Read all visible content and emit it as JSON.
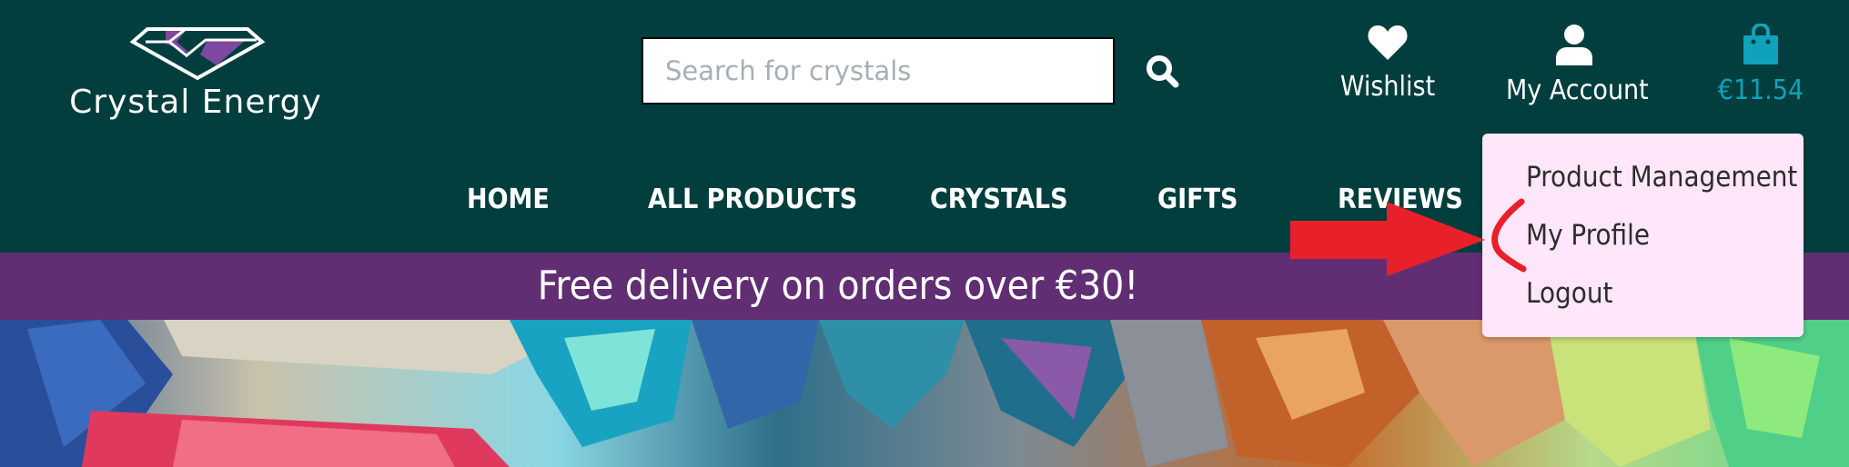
{
  "brand": {
    "name": "Crystal Energy",
    "logo_icon": "crystal-logo"
  },
  "search": {
    "placeholder": "Search for crystals",
    "value": "",
    "icon": "search-icon"
  },
  "actions": {
    "wishlist": {
      "label": "Wishlist",
      "icon": "heart-icon"
    },
    "account": {
      "label": "My Account",
      "icon": "user-icon"
    },
    "cart": {
      "label": "€11.54",
      "icon": "shopping-bag-icon"
    }
  },
  "nav": {
    "items": [
      {
        "label": "HOME"
      },
      {
        "label": "ALL PRODUCTS"
      },
      {
        "label": "CRYSTALS"
      },
      {
        "label": "GIFTS"
      },
      {
        "label": "REVIEWS"
      }
    ]
  },
  "banner": {
    "text": "Free delivery on orders over €30!"
  },
  "account_menu": {
    "items": [
      {
        "label": "Product Management"
      },
      {
        "label": "My Profile"
      },
      {
        "label": "Logout"
      }
    ]
  },
  "colors": {
    "header_bg": "#013e3d",
    "banner_bg": "#612e73",
    "cart_accent": "#0ea2bb",
    "dropdown_bg": "#ffe6fa",
    "annotation_red": "#e8202a"
  }
}
